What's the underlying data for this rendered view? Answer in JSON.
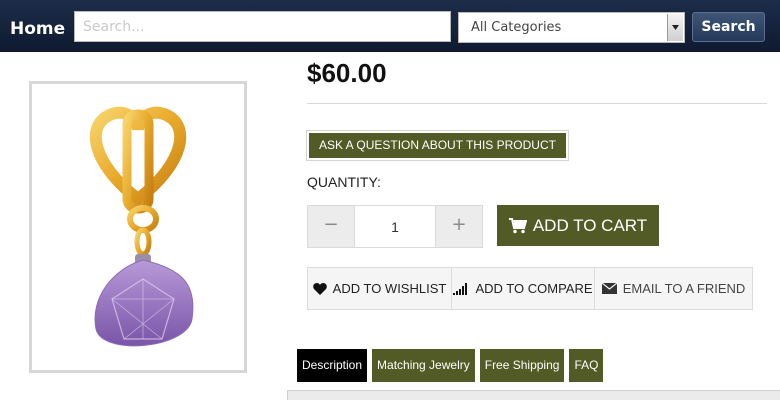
{
  "nav": {
    "home_label": "Home",
    "search_placeholder": "Search...",
    "search_value": "",
    "category_selected": "All Categories",
    "search_button": "Search"
  },
  "product": {
    "price": "$60.00",
    "ask_question_label": "ASK A QUESTION ABOUT THIS PRODUCT",
    "quantity_label": "QUANTITY:",
    "quantity_value": "1",
    "minus_label": "−",
    "plus_label": "+",
    "add_to_cart_label": "ADD TO CART",
    "image_icon": "gold-heart-amethyst-charm"
  },
  "actions": {
    "wishlist": "ADD TO WISHLIST",
    "compare": "ADD TO COMPARE",
    "email": "EMAIL TO A FRIEND"
  },
  "tabs": [
    {
      "label": "Description",
      "active": true
    },
    {
      "label": "Matching Jewelry",
      "active": false
    },
    {
      "label": "Free Shipping",
      "active": false
    },
    {
      "label": "FAQ",
      "active": false
    }
  ],
  "colors": {
    "nav_bg": "#15223b",
    "olive": "#525a25",
    "active_tab": "#000000"
  }
}
